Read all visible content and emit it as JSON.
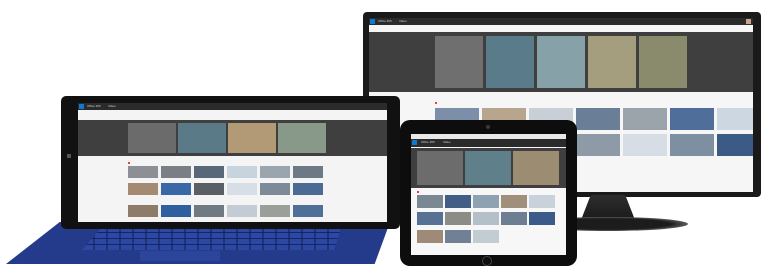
{
  "scene": {
    "background": "#ffffff"
  },
  "app": {
    "brand": "Office 365",
    "section": "Video",
    "accent": "#0f78d4"
  },
  "monitor": {
    "hero_colors": [
      "#6f6f6f",
      "#5a7b8a",
      "#86a2a8",
      "#a49e7f",
      "#8a8a6d"
    ],
    "row1_colors": [
      "#7d8fa8",
      "#b8a58e",
      "#c9cfd6",
      "#6b7e98",
      "#9aa4aa",
      "#4f6e9a",
      "#cdd7e1"
    ],
    "row2_colors": [
      "#5b6e86",
      "#a79b87",
      "#4a6ea1",
      "#8e9aa6",
      "#d6dde4",
      "#7f8fa2",
      "#3b5a86"
    ]
  },
  "laptop": {
    "hero_colors": [
      "#6b6b6b",
      "#5b7a88",
      "#b29a77",
      "#88998a"
    ],
    "row1_colors": [
      "#8c8f95",
      "#7a7f86",
      "#596878",
      "#c7d3dd",
      "#9aa5ad",
      "#6d7a85"
    ],
    "row2_colors": [
      "#a48a72",
      "#3a67a6",
      "#5a5f66",
      "#d7dee6",
      "#7d8a98",
      "#4b6b95"
    ],
    "row3_colors": [
      "#8e7c6a",
      "#2f5f9e",
      "#6f7a82",
      "#c3ccd4",
      "#9a9f9a",
      "#4d6f98"
    ],
    "keyboard_color": "#243a8a"
  },
  "tablet": {
    "hero_colors": [
      "#6c6c6c",
      "#5f7f8b",
      "#9c8d72"
    ],
    "row1_colors": [
      "#7a8894",
      "#425e86",
      "#8fa2b2",
      "#a08f7b",
      "#c9d2da"
    ],
    "row2_colors": [
      "#587093",
      "#8c8c86",
      "#b5bfc9",
      "#6d7e92",
      "#3a5b8a"
    ],
    "row3_colors": [
      "#9e8a77",
      "#708095",
      "#c4ccd3"
    ]
  }
}
